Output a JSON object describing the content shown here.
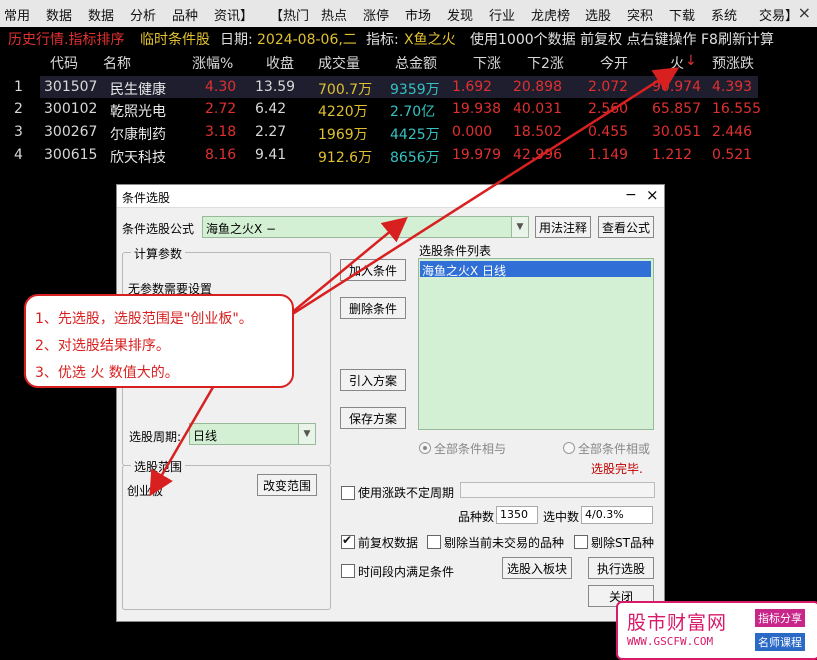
{
  "menu": [
    "常用",
    "数据",
    "数据",
    "分析",
    "品种",
    "资讯】",
    "【热门",
    "热点",
    "涨停",
    "市场",
    "发现",
    "行业",
    "龙虎榜",
    "选股",
    "突积",
    "下载",
    "系统",
    "交易】"
  ],
  "menu_close": "×",
  "titlebar": {
    "mode": "历史行情.指标排序",
    "sub": "临时条件股",
    "date_label": "日期:",
    "date": "2024-08-06,二",
    "indicator_label": "指标:",
    "indicator": "X鱼之火",
    "info": "使用1000个数据 前复权 点右键操作 F8刷新计算"
  },
  "table": {
    "headers": [
      "代码",
      "名称",
      "涨幅%",
      "收盘",
      "成交量",
      "总金额",
      "下涨",
      "下2涨",
      "今开",
      "火",
      "预涨跌"
    ],
    "sort_arrow": "↓",
    "rows": [
      {
        "idx": "1",
        "code": "301507",
        "name": "民生健康",
        "pct": "4.30",
        "close": "13.59",
        "vol": "700.7万",
        "amt": "9359万",
        "xz": "1.692",
        "x2z": "20.898",
        "open": "2.072",
        "fire": "90.974",
        "pred": "4.393"
      },
      {
        "idx": "2",
        "code": "300102",
        "name": "乾照光电",
        "pct": "2.72",
        "close": "6.42",
        "vol": "4220万",
        "amt": "2.70亿",
        "xz": "19.938",
        "x2z": "40.031",
        "open": "2.560",
        "fire": "65.857",
        "pred": "16.555"
      },
      {
        "idx": "3",
        "code": "300267",
        "name": "尔康制药",
        "pct": "3.18",
        "close": "2.27",
        "vol": "1969万",
        "amt": "4425万",
        "xz": "0.000",
        "x2z": "18.502",
        "open": "0.455",
        "fire": "30.051",
        "pred": "2.446"
      },
      {
        "idx": "4",
        "code": "300615",
        "name": "欣天科技",
        "pct": "8.16",
        "close": "9.41",
        "vol": "912.6万",
        "amt": "8656万",
        "xz": "19.979",
        "x2z": "42.996",
        "open": "1.149",
        "fire": "1.212",
        "pred": "0.521"
      }
    ]
  },
  "dialog": {
    "title": "条件选股",
    "min": "−",
    "close": "×",
    "formula_label": "条件选股公式",
    "formula_value": "海鱼之火X   −",
    "usage_btn": "用法注释",
    "view_btn": "查看公式",
    "calc_group": "计算参数",
    "calc_note": "无参数需要设置",
    "add_btn": "加入条件",
    "del_btn": "删除条件",
    "import_btn": "引入方案",
    "save_btn": "保存方案",
    "list_label": "选股条件列表",
    "list_item": "海鱼之火X   日线",
    "period_label": "选股周期:",
    "period_value": "日线",
    "radio_all_and": "全部条件相与",
    "radio_all_or": "全部条件相或",
    "status": "选股完毕.",
    "range_group": "选股范围",
    "range_value": "创业板",
    "change_range_btn": "改变范围",
    "use_period_label": "使用涨跌不定周期",
    "count_label": "品种数",
    "count_value": "1350",
    "hit_label": "选中数",
    "hit_value": "4/0.3%",
    "fq_label": "前复权数据",
    "exclude_label": "剔除当前未交易的品种",
    "st_label": "剔除ST品种",
    "timespan_label": "时间段内满足条件",
    "to_block_btn": "选股入板块",
    "exec_btn": "执行选股",
    "close_btn": "关闭"
  },
  "annotation": [
    "1、先选股，选股范围是\"创业板\"。",
    "2、对选股结果排序。",
    "3、优选 火 数值大的。"
  ],
  "watermark": {
    "site": "股市财富网",
    "url": "WWW.GSCFW.COM",
    "tag1": "指标分享",
    "tag2": "名师课程"
  }
}
